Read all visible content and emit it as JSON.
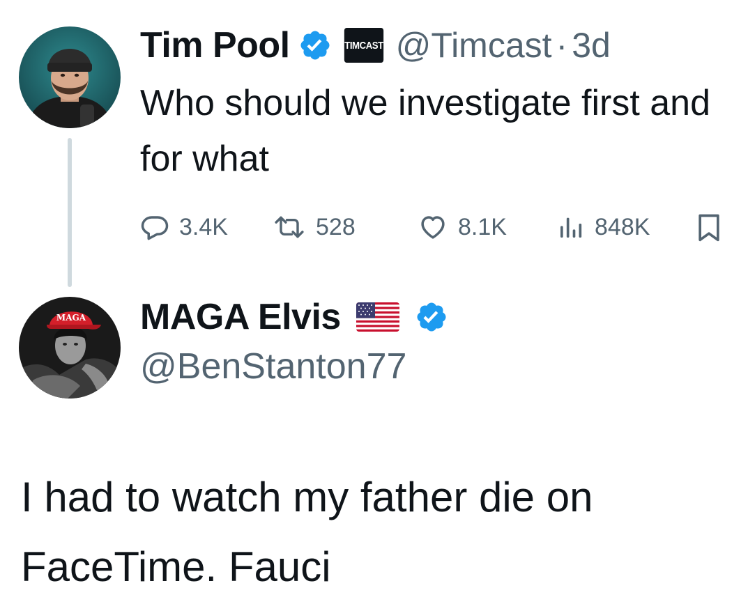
{
  "original_tweet": {
    "display_name": "Tim Pool",
    "affiliate_badge": "TIMCAST",
    "handle": "@Timcast",
    "separator": "·",
    "time": "3d",
    "text": "Who should we investigate first and for what",
    "metrics": {
      "replies": "3.4K",
      "retweets": "528",
      "likes": "8.1K",
      "views": "848K"
    }
  },
  "reply_tweet": {
    "display_name": "MAGA Elvis",
    "flag": "🇺🇸",
    "handle": "@BenStanton77",
    "hat_text": "MAGA",
    "text": "I had to watch my father die on FaceTime. Fauci"
  },
  "icons": {
    "verified": "verified-checkmark-icon",
    "reply": "speech-bubble-icon",
    "retweet": "retweet-arrows-icon",
    "like": "heart-icon",
    "views": "bar-chart-icon",
    "bookmark": "bookmark-icon"
  },
  "colors": {
    "verified_blue": "#1d9bf0",
    "text_primary": "#0f1419",
    "text_secondary": "#536471",
    "thread_line": "#cfd9de"
  }
}
